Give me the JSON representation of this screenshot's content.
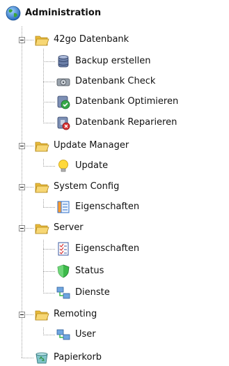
{
  "tree": {
    "root": {
      "label": "Administration",
      "icon": "globe-icon"
    },
    "nodes": [
      {
        "label": "42go Datenbank",
        "icon": "folder-open-icon",
        "expanded": true,
        "children": [
          {
            "label": "Backup erstellen",
            "icon": "database-icon"
          },
          {
            "label": "Datenbank Check",
            "icon": "disk-check-icon"
          },
          {
            "label": "Datenbank Optimieren",
            "icon": "optimize-check-icon"
          },
          {
            "label": "Datenbank Reparieren",
            "icon": "repair-icon"
          }
        ]
      },
      {
        "label": "Update Manager",
        "icon": "folder-open-icon",
        "expanded": true,
        "children": [
          {
            "label": "Update",
            "icon": "lightbulb-icon"
          }
        ]
      },
      {
        "label": "System Config",
        "icon": "folder-open-icon",
        "expanded": true,
        "children": [
          {
            "label": "Eigenschaften",
            "icon": "properties-icon"
          }
        ]
      },
      {
        "label": "Server",
        "icon": "folder-open-icon",
        "expanded": true,
        "children": [
          {
            "label": "Eigenschaften",
            "icon": "checklist-icon"
          },
          {
            "label": "Status",
            "icon": "shield-icon"
          },
          {
            "label": "Dienste",
            "icon": "network-icon"
          }
        ]
      },
      {
        "label": "Remoting",
        "icon": "folder-open-icon",
        "expanded": true,
        "children": [
          {
            "label": "User",
            "icon": "users-icon"
          }
        ]
      }
    ],
    "trash": {
      "label": "Papierkorb",
      "icon": "recycle-bin-icon"
    }
  }
}
